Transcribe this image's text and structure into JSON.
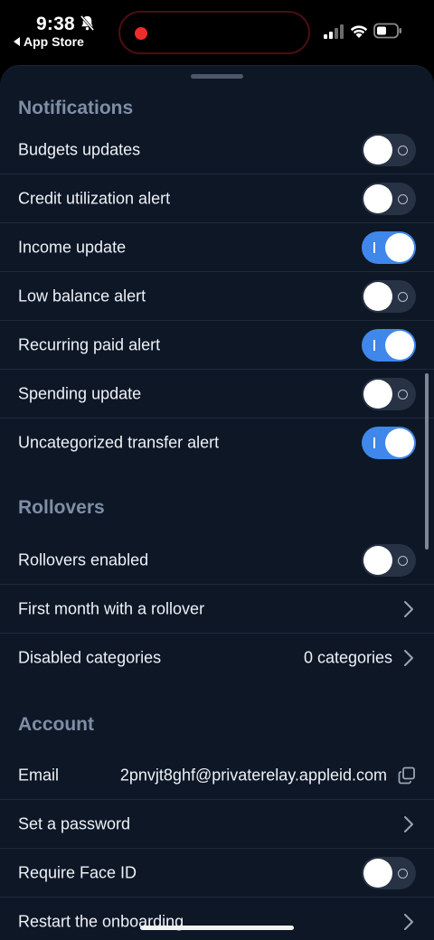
{
  "status_bar": {
    "time": "9:38",
    "back_label": "App Store",
    "bell_icon": "bell-slash-icon",
    "signal_icon": "cellular-signal-icon",
    "wifi_icon": "wifi-icon",
    "battery_icon": "battery-icon",
    "recording_color": "#ef2b2b"
  },
  "accent_color": "#3f87ea",
  "notifications": {
    "title": "Notifications",
    "items": [
      {
        "label": "Budgets updates",
        "on": false
      },
      {
        "label": "Credit utilization alert",
        "on": false
      },
      {
        "label": "Income update",
        "on": true
      },
      {
        "label": "Low balance alert",
        "on": false
      },
      {
        "label": "Recurring paid alert",
        "on": true
      },
      {
        "label": "Spending update",
        "on": false
      },
      {
        "label": "Uncategorized transfer alert",
        "on": true
      }
    ]
  },
  "rollovers": {
    "title": "Rollovers",
    "enabled_label": "Rollovers enabled",
    "enabled_on": false,
    "first_month_label": "First month with a rollover",
    "disabled_label": "Disabled categories",
    "disabled_value": "0 categories"
  },
  "account": {
    "title": "Account",
    "email_label": "Email",
    "email_value": "2pnvjt8ghf@privaterelay.appleid.com",
    "password_label": "Set a password",
    "faceid_label": "Require Face ID",
    "faceid_on": false,
    "restart_label": "Restart the onboarding"
  }
}
